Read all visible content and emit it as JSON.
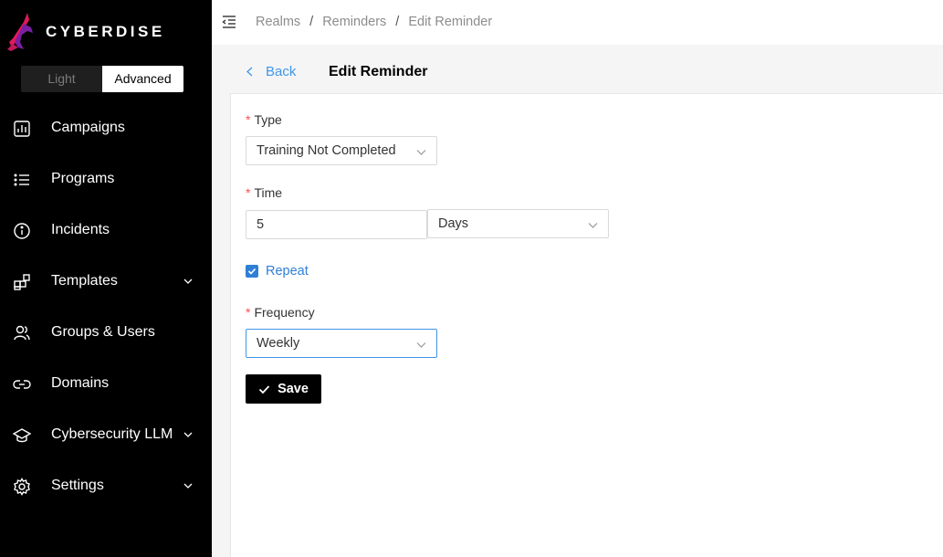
{
  "brand": {
    "name": "CYBERDISE",
    "accent": "#e0195a"
  },
  "mode_toggle": {
    "light": "Light",
    "advanced": "Advanced",
    "active": "Advanced"
  },
  "sidebar": {
    "items": [
      {
        "label": "Campaigns",
        "icon": "bar-chart-icon",
        "has_submenu": false
      },
      {
        "label": "Programs",
        "icon": "list-icon",
        "has_submenu": false
      },
      {
        "label": "Incidents",
        "icon": "info-circle-icon",
        "has_submenu": false
      },
      {
        "label": "Templates",
        "icon": "appstore-add-icon",
        "has_submenu": true
      },
      {
        "label": "Groups & Users",
        "icon": "users-icon",
        "has_submenu": false
      },
      {
        "label": "Domains",
        "icon": "link-icon",
        "has_submenu": false
      },
      {
        "label": "Cybersecurity LLM",
        "icon": "graduation-cap-icon",
        "has_submenu": true
      },
      {
        "label": "Settings",
        "icon": "gear-icon",
        "has_submenu": true
      }
    ]
  },
  "breadcrumb": [
    "Realms",
    "Reminders",
    "Edit Reminder"
  ],
  "page": {
    "back_label": "Back",
    "title": "Edit Reminder"
  },
  "form": {
    "type_label": "Type",
    "type_value": "Training Not Completed",
    "time_label": "Time",
    "time_value": "5",
    "time_unit": "Days",
    "repeat_label": "Repeat",
    "repeat_checked": true,
    "frequency_label": "Frequency",
    "frequency_value": "Weekly",
    "save_label": "Save"
  },
  "colors": {
    "link": "#4096e8",
    "required": "#ff4d4f",
    "checkbox": "#2f7fd6"
  }
}
